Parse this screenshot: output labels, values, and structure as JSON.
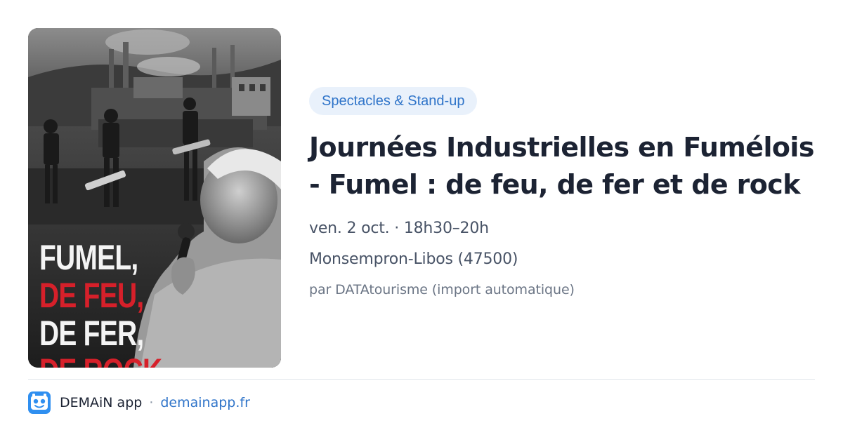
{
  "event": {
    "category": "Spectacles & Stand-up",
    "title_line1": "Journées Industrielles en Fumélois",
    "title_line2": "- Fumel : de feu, de fer et de rock",
    "date": "ven. 2 oct. · 18h30–20h",
    "location": "Monsempron-Libos (47500)",
    "source": "par DATAtourisme (import automatique)"
  },
  "poster": {
    "line1": "FUMEL,",
    "line2": "DE FEU,",
    "line3": "DE FER,",
    "line4": "DE ROCK"
  },
  "footer": {
    "app_name": "DEMAiN app",
    "separator": "·",
    "app_link": "demainapp.fr"
  },
  "colors": {
    "accent": "#2f74c9",
    "badge_bg": "#e9f1fb",
    "poster_red": "#d6202a"
  }
}
